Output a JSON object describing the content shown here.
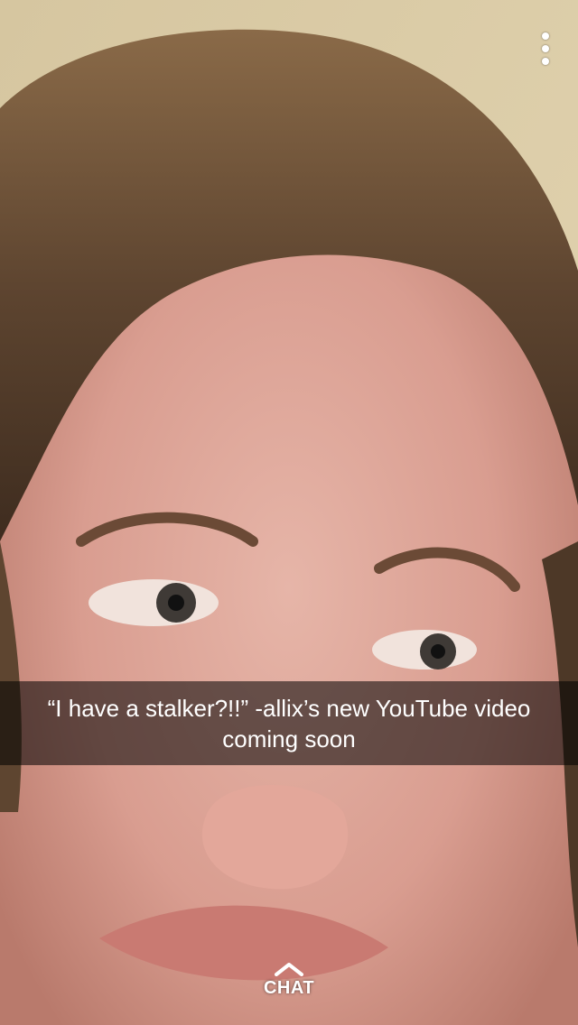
{
  "story": {
    "caption": "“I have a stalker?!!” -allix’s new YouTube video coming soon"
  },
  "chat": {
    "label": "CHAT"
  },
  "icons": {
    "menu": "vertical-ellipsis-icon",
    "chat_arrow": "chevron-up-icon"
  },
  "colors": {
    "text": "#ffffff",
    "caption_bar": "rgba(0,0,0,0.55)"
  }
}
